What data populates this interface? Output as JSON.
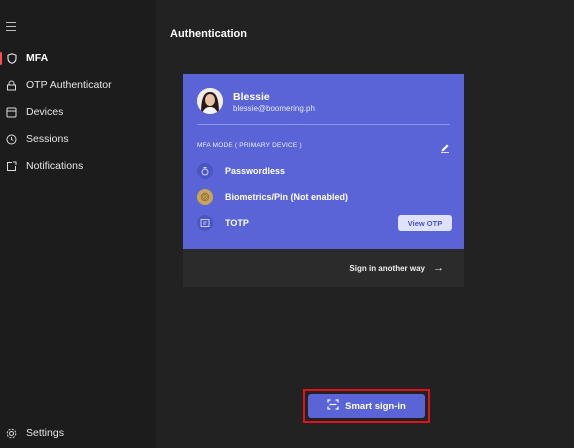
{
  "window": {
    "controls": [
      "minimize",
      "maximize",
      "close"
    ]
  },
  "sidebar": {
    "items": [
      {
        "label": "MFA",
        "icon": "shield-icon",
        "active": true
      },
      {
        "label": "OTP Authenticator",
        "icon": "otp-icon"
      },
      {
        "label": "Devices",
        "icon": "devices-icon"
      },
      {
        "label": "Sessions",
        "icon": "clock-icon"
      },
      {
        "label": "Notifications",
        "icon": "notification-icon"
      }
    ],
    "settings_label": "Settings",
    "active_color": "#ff4d4d"
  },
  "main": {
    "title": "Authentication"
  },
  "card": {
    "user_name": "Blessie",
    "user_email": "blessie@boomering.ph",
    "mfa_mode_label": "MFA MODE   ( PRIMARY  DEVICE )",
    "methods": [
      {
        "label": "Passwordless",
        "icon": "passwordless-icon"
      },
      {
        "label": "Biometrics/Pin (Not enabled)",
        "icon": "fingerprint-icon"
      },
      {
        "label": "TOTP",
        "icon": "totp-icon"
      }
    ],
    "view_otp_label": "View OTP",
    "accent": "#5a64d6"
  },
  "signin_other": {
    "label": "Sign in another way"
  },
  "smart_signin": {
    "label": "Smart sign-in",
    "highlight_color": "#e0131a"
  }
}
